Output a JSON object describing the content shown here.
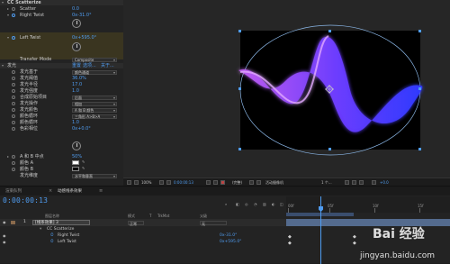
{
  "effects": {
    "header": "CC Scatterize",
    "scatter_label": "Scatter",
    "scatter_value": "0.0",
    "right_twist_label": "Right Twist",
    "right_twist_value": "0x-31.0°",
    "left_twist_label": "Left Twist",
    "left_twist_value": "0x+595.0°",
    "transfer_mode_label": "Transfer Mode",
    "transfer_mode_value": "Composite",
    "glow_header": "发光",
    "glow_header_links": [
      "重置",
      "选项...",
      "关于..."
    ],
    "glow_rows": [
      {
        "label": "发光基于",
        "value": "颜色通道",
        "kind": "dropdown"
      },
      {
        "label": "发光阈值",
        "value": "36.0%",
        "kind": "value"
      },
      {
        "label": "发光半径",
        "value": "17.0",
        "kind": "value"
      },
      {
        "label": "发光强度",
        "value": "1.0",
        "kind": "value"
      },
      {
        "label": "合成原始项目",
        "value": "后面",
        "kind": "dropdown"
      },
      {
        "label": "发光操作",
        "value": "相加",
        "kind": "dropdown"
      },
      {
        "label": "发光颜色",
        "value": "A 和 B 颜色",
        "kind": "dropdown"
      },
      {
        "label": "颜色循环",
        "value": "三角形 A>B>A",
        "kind": "dropdown"
      },
      {
        "label": "颜色循环",
        "value": "1.0",
        "kind": "value"
      },
      {
        "label": "色彩相位",
        "value": "0x+0.0°",
        "kind": "value"
      }
    ],
    "ab_mid_label": "A 和 B 中点",
    "ab_mid_value": "50%",
    "color_a_label": "颜色 A",
    "color_b_label": "颜色 B",
    "glow_dim_label": "发光维度",
    "glow_dim_value": "水平和垂直"
  },
  "viewer": {
    "bar": {
      "zoom": "100%",
      "timecode": "0:00:00:13",
      "resolution": "(完整)",
      "camera": "活动摄像机",
      "views": "1 个...",
      "exposure": "+0.0"
    }
  },
  "timeline": {
    "tabs": [
      "渲染队列",
      "动感线条效果"
    ],
    "timecode": "0:00:00:13",
    "columns": [
      "图层名称",
      "模式",
      "T",
      "TrkMat",
      "父级"
    ],
    "ruler_labels": [
      "00f",
      "05f",
      "10f",
      "15f"
    ],
    "layer": {
      "number": "1",
      "name": "[线条效果] 3",
      "mode": "正常",
      "parent": "无"
    },
    "effect_name": "CC Scatterize",
    "right_twist_label": "Right Twist",
    "right_twist_value": "0x-31.0°",
    "left_twist_label": "Left Twist",
    "left_twist_value": "0x+595.0°"
  },
  "colors": {
    "accent_blue": "#4f9cf0",
    "glow_color_a": "#ffffff",
    "glow_color_b": "#000000",
    "ribbon_start": "#c05cf0",
    "ribbon_end": "#2f3bff"
  },
  "watermark": {
    "logo": "Bai 经验",
    "url": "jingyan.baidu.com"
  }
}
